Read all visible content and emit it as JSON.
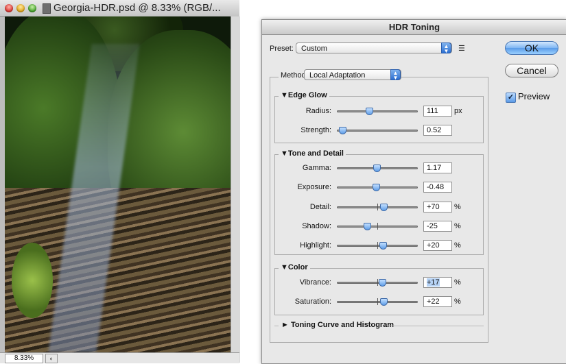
{
  "document": {
    "title": "Georgia-HDR.psd @ 8.33% (RGB/...",
    "zoom": "8.33%"
  },
  "dialog": {
    "title": "HDR Toning",
    "preset_label": "Preset:",
    "preset_value": "Custom",
    "method_label": "Method:",
    "method_value": "Local Adaptation",
    "ok_label": "OK",
    "cancel_label": "Cancel",
    "preview_label": "Preview",
    "preview_checked": true,
    "sections": {
      "edge_glow": {
        "title": "Edge Glow",
        "rows": [
          {
            "label": "Radius:",
            "value": "111",
            "unit": "px",
            "slider_fraction": 0.4
          },
          {
            "label": "Strength:",
            "value": "0.52",
            "unit": "",
            "slider_fraction": 0.07
          }
        ]
      },
      "tone_detail": {
        "title": "Tone and Detail",
        "rows": [
          {
            "label": "Gamma:",
            "value": "1.17",
            "unit": "",
            "slider_fraction": 0.49
          },
          {
            "label": "Exposure:",
            "value": "-0.48",
            "unit": "",
            "slider_fraction": 0.48
          },
          {
            "label": "Detail:",
            "value": "+70",
            "unit": "%",
            "slider_fraction": 0.58
          },
          {
            "label": "Shadow:",
            "value": "-25",
            "unit": "%",
            "slider_fraction": 0.37
          },
          {
            "label": "Highlight:",
            "value": "+20",
            "unit": "%",
            "slider_fraction": 0.57
          }
        ]
      },
      "color": {
        "title": "Color",
        "rows": [
          {
            "label": "Vibrance:",
            "value": "+17",
            "unit": "%",
            "slider_fraction": 0.56
          },
          {
            "label": "Saturation:",
            "value": "+22",
            "unit": "%",
            "slider_fraction": 0.58
          }
        ]
      },
      "toning_curve": {
        "title": "Toning Curve and Histogram"
      }
    }
  }
}
